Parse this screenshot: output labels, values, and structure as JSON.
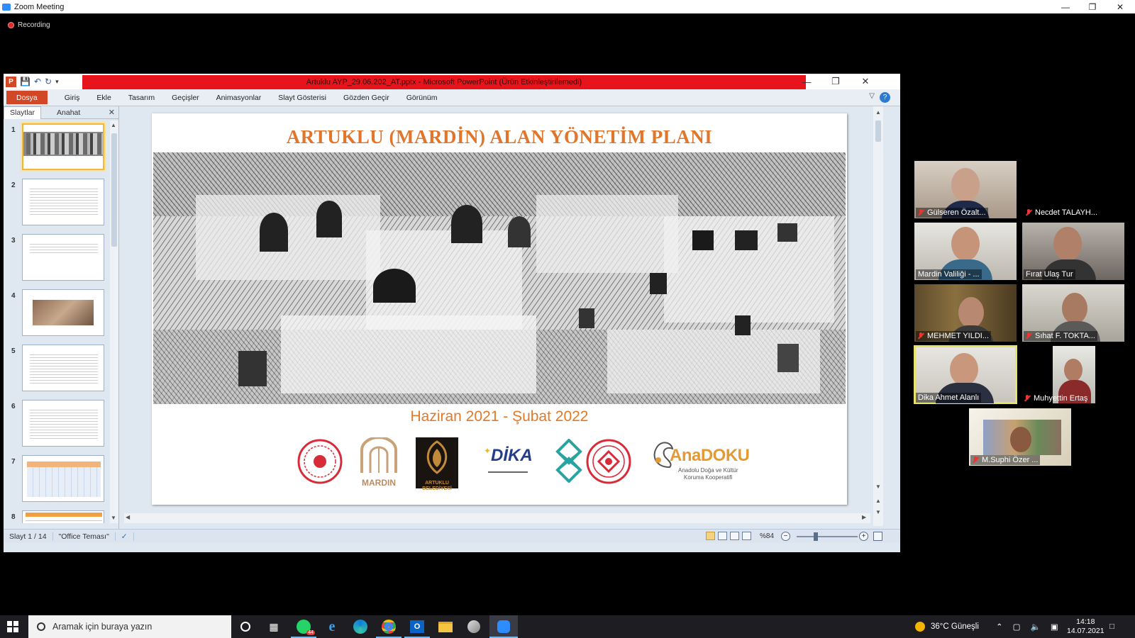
{
  "zoom": {
    "title": "Zoom Meeting",
    "recording": "Recording"
  },
  "ppt": {
    "window_title": "Artuklu AYP_29.06.202_AT.pptx - Microsoft PowerPoint (Ürün Etkinleştirilemedi)",
    "tabs": [
      "Dosya",
      "Giriş",
      "Ekle",
      "Tasarım",
      "Geçişler",
      "Animasyonlar",
      "Slayt Gösterisi",
      "Gözden Geçir",
      "Görünüm"
    ],
    "panel_tabs": [
      "Slaytlar",
      "Anahat"
    ],
    "thumb_numbers": [
      "1",
      "2",
      "3",
      "4",
      "5",
      "6",
      "7",
      "8"
    ],
    "slide": {
      "title": "ARTUKLU (MARDİN) ALAN YÖNETİM PLANI",
      "date": "Haziran 2021 - Şubat 2022",
      "logo_mardin": "MARDIN",
      "logo_artuklu": "ARTUKLU BELEDİYESİ",
      "logo_dika": "DİKA",
      "logo_anadoku": "AnaDOKU",
      "logo_anadoku_sub1": "Anadolu Doğa ve Kültür",
      "logo_anadoku_sub2": "Koruma Kooperatifi"
    },
    "status": {
      "slide_count": "Slayt 1 / 14",
      "theme": "\"Office Teması\"",
      "zoom": "%84"
    }
  },
  "participants": [
    {
      "name": "Gülseren Özalt...",
      "muted": true
    },
    {
      "name": "Necdet TALAYH...",
      "muted": true
    },
    {
      "name": "Mardin Valiliği - ...",
      "muted": false
    },
    {
      "name": "Fırat Ulaş Tur",
      "muted": false
    },
    {
      "name": "MEHMET YILDI...",
      "muted": true
    },
    {
      "name": "Sıhat F. TOKTA...",
      "muted": true
    },
    {
      "name": "Dika Ahmet Alanlı",
      "muted": false
    },
    {
      "name": "Muhyettin Ertaş",
      "muted": true
    },
    {
      "name": "M.Suphi Özer ...",
      "muted": true
    }
  ],
  "taskbar": {
    "search_placeholder": "Aramak için buraya yazın",
    "whatsapp_badge": "44",
    "weather": "36°C  Güneşli",
    "time": "14:18",
    "date": "14.07.2021"
  },
  "colors": {
    "title_red": "#e8141b",
    "slide_orange": "#e0752c",
    "zoom_blue": "#2d8cff",
    "active_speaker": "#e6e36a"
  }
}
